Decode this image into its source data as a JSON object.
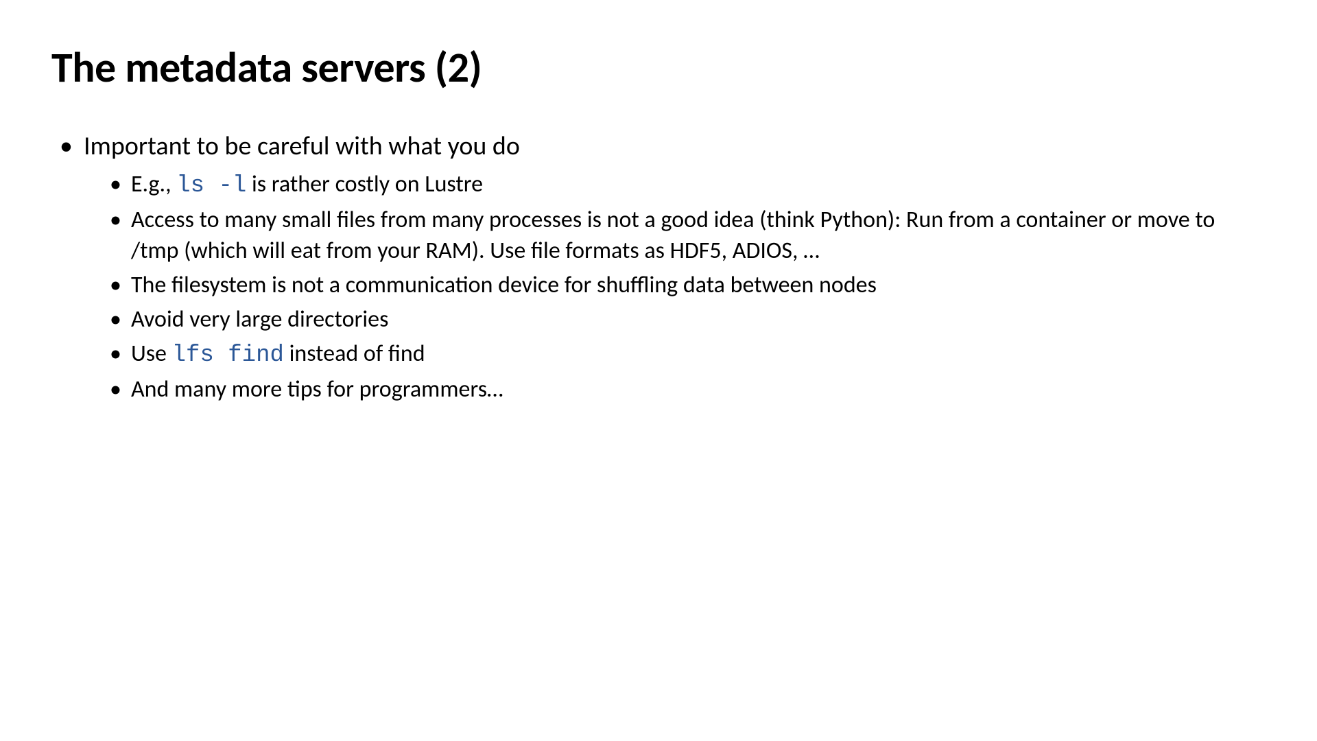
{
  "slide": {
    "title": "The metadata servers (2)",
    "bullets": {
      "main": "Important to be careful with what you do",
      "sub1_pre": "E.g., ",
      "sub1_code": "ls -l",
      "sub1_post": " is rather costly on Lustre",
      "sub2": "Access to many small files from many processes is not a good idea (think Python): Run from a container or move to /tmp (which will eat from your RAM). Use file formats as HDF5, ADIOS, …",
      "sub3": "The filesystem is not a communication device for shuffling data between nodes",
      "sub4": "Avoid very large directories",
      "sub5_pre": "Use ",
      "sub5_code": "lfs find",
      "sub5_post": " instead of find",
      "sub6": "And many more tips for programmers…"
    }
  }
}
